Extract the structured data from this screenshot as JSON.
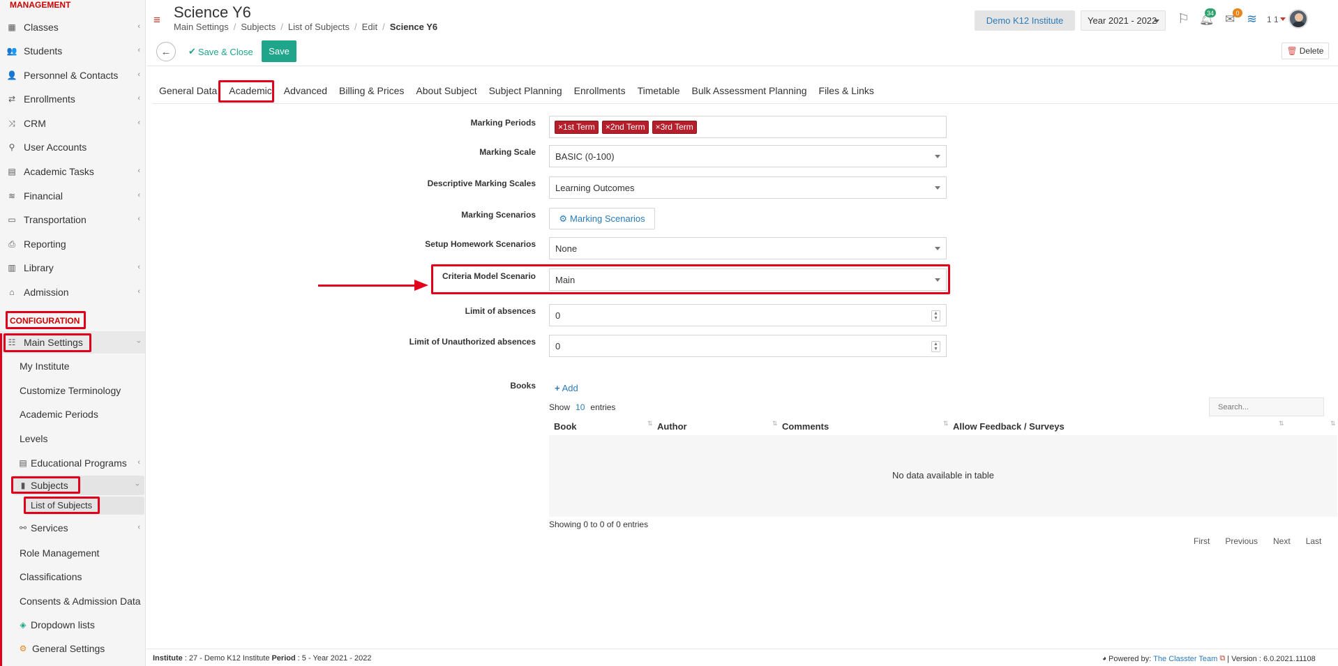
{
  "sidebar": {
    "management_title": "MANAGEMENT",
    "management_items": [
      {
        "label": "Classes",
        "icon": "classes-icon",
        "chevron": "‹"
      },
      {
        "label": "Students",
        "icon": "students-icon",
        "chevron": "‹"
      },
      {
        "label": "Personnel & Contacts",
        "icon": "personnel-icon",
        "chevron": "‹"
      },
      {
        "label": "Enrollments",
        "icon": "enrollments-icon",
        "chevron": "‹"
      },
      {
        "label": "CRM",
        "icon": "crm-icon",
        "chevron": "‹"
      },
      {
        "label": "User Accounts",
        "icon": "key-icon",
        "chevron": ""
      },
      {
        "label": "Academic Tasks",
        "icon": "tasks-icon",
        "chevron": "‹"
      },
      {
        "label": "Financial",
        "icon": "financial-icon",
        "chevron": "‹"
      },
      {
        "label": "Transportation",
        "icon": "bus-icon",
        "chevron": "‹"
      },
      {
        "label": "Reporting",
        "icon": "printer-icon",
        "chevron": ""
      },
      {
        "label": "Library",
        "icon": "library-icon",
        "chevron": "‹"
      },
      {
        "label": "Admission",
        "icon": "admission-icon",
        "chevron": "‹"
      }
    ],
    "configuration_title": "CONFIGURATION",
    "main_settings": {
      "label": "Main Settings",
      "chevron": "‹"
    },
    "main_settings_items": [
      {
        "label": "My Institute"
      },
      {
        "label": "Customize Terminology"
      },
      {
        "label": "Academic Periods"
      },
      {
        "label": "Levels"
      }
    ],
    "educational_programs": {
      "label": "Educational Programs",
      "chevron": "‹"
    },
    "subjects": {
      "label": "Subjects",
      "chevron": "‹"
    },
    "list_of_subjects": "List of Subjects",
    "services": {
      "label": "Services",
      "chevron": "‹"
    },
    "more_items": [
      {
        "label": "Role Management"
      },
      {
        "label": "Classifications"
      },
      {
        "label": "Consents & Admission Data"
      }
    ],
    "dropdown_lists": "Dropdown lists",
    "general_settings": "General Settings"
  },
  "header": {
    "title": "Science Y6",
    "breadcrumb": [
      "Main Settings",
      "Subjects",
      "List of Subjects",
      "Edit",
      "Science Y6"
    ],
    "institute_button": "Demo K12 Institute",
    "year_select": "Year 2021 - 2022",
    "notifications_count": "34",
    "messages_count": "0",
    "user_label": "1 1"
  },
  "toolbar": {
    "save_close": "Save & Close",
    "save": "Save",
    "delete": "Delete"
  },
  "tabs": [
    "General Data",
    "Academic",
    "Advanced",
    "Billing & Prices",
    "About Subject",
    "Subject Planning",
    "Enrollments",
    "Timetable",
    "Bulk Assessment Planning",
    "Files & Links"
  ],
  "form": {
    "marking_periods_label": "Marking Periods",
    "marking_periods": [
      "×1st Term",
      "×2nd Term",
      "×3rd Term"
    ],
    "marking_scale_label": "Marking Scale",
    "marking_scale_value": "BASIC (0-100)",
    "descriptive_label": "Descriptive Marking Scales",
    "descriptive_value": "Learning Outcomes",
    "scenarios_label": "Marking Scenarios",
    "scenarios_button": "Marking Scenarios",
    "homework_label": "Setup Homework Scenarios",
    "homework_value": "None",
    "criteria_label": "Criteria Model Scenario",
    "criteria_value": "Main",
    "absences_label": "Limit of absences",
    "absences_value": "0",
    "unauth_label": "Limit of Unauthorized absences",
    "unauth_value": "0"
  },
  "books": {
    "label": "Books",
    "add": "Add",
    "show": "Show",
    "show_count": "10",
    "entries": "entries",
    "search_placeholder": "Search...",
    "columns": [
      "Book",
      "Author",
      "Comments",
      "Allow Feedback / Surveys"
    ],
    "empty": "No data available in table",
    "info": "Showing 0 to 0 of 0 entries",
    "pager": [
      "First",
      "Previous",
      "Next",
      "Last"
    ]
  },
  "footer": {
    "institute_label": "Institute",
    "institute_value": ": 27 - Demo K12 Institute",
    "period_label": "Period",
    "period_value": ": 5 - Year 2021 - 2022",
    "powered_by": "Powered by:",
    "team": "The Classter Team",
    "version": "| Version : 6.0.2021.11108"
  },
  "colors": {
    "accent": "#1fa58a",
    "highlight": "#e0001b",
    "chip": "#b41f2b",
    "link": "#2a7ab8"
  }
}
